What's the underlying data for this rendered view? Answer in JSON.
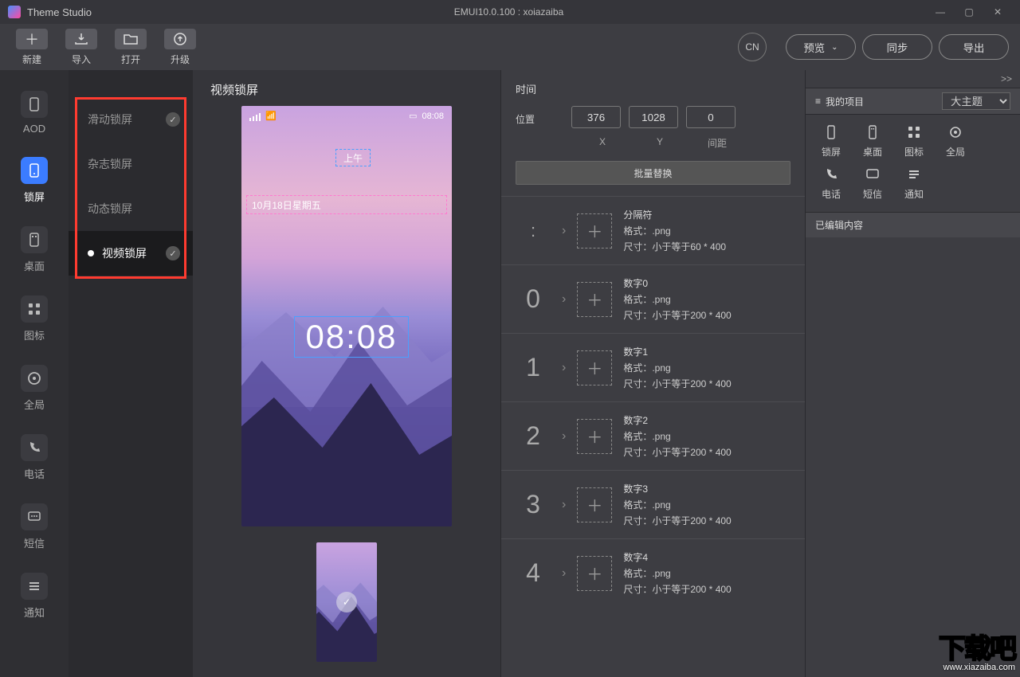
{
  "titlebar": {
    "app": "Theme Studio",
    "center": "EMUI10.0.100 : xoiazaiba"
  },
  "toolbar": {
    "new": "新建",
    "import": "导入",
    "open": "打开",
    "upgrade": "升级",
    "lang": "CN",
    "preview": "预览",
    "sync": "同步",
    "export": "导出"
  },
  "leftnav": [
    {
      "key": "aod",
      "label": "AOD"
    },
    {
      "key": "lock",
      "label": "锁屏",
      "active": true
    },
    {
      "key": "desktop",
      "label": "桌面"
    },
    {
      "key": "icons",
      "label": "图标"
    },
    {
      "key": "global",
      "label": "全局"
    },
    {
      "key": "phone",
      "label": "电话"
    },
    {
      "key": "sms",
      "label": "短信"
    },
    {
      "key": "notify",
      "label": "通知"
    }
  ],
  "subnav": [
    {
      "label": "滑动锁屏",
      "checked": true
    },
    {
      "label": "杂志锁屏"
    },
    {
      "label": "动态锁屏"
    },
    {
      "label": "视频锁屏",
      "active": true,
      "checked": true
    }
  ],
  "preview": {
    "title": "视频锁屏",
    "status_time": "08:08",
    "ampm": "上午",
    "date": "10月18日星期五",
    "clock": "08:08"
  },
  "props": {
    "section_time": "时间",
    "pos_label": "位置",
    "x": "376",
    "y": "1028",
    "gap": "0",
    "xl": "X",
    "yl": "Y",
    "gapl": "间距",
    "batch": "批量替换",
    "rows": [
      {
        "num": ":",
        "title": "分隔符",
        "fmt": "格式：.png",
        "size": "尺寸：小于等于60 * 400",
        "sep": true
      },
      {
        "num": "0",
        "title": "数字0",
        "fmt": "格式：.png",
        "size": "尺寸：小于等于200 * 400"
      },
      {
        "num": "1",
        "title": "数字1",
        "fmt": "格式：.png",
        "size": "尺寸：小于等于200 * 400"
      },
      {
        "num": "2",
        "title": "数字2",
        "fmt": "格式：.png",
        "size": "尺寸：小于等于200 * 400"
      },
      {
        "num": "3",
        "title": "数字3",
        "fmt": "格式：.png",
        "size": "尺寸：小于等于200 * 400"
      },
      {
        "num": "4",
        "title": "数字4",
        "fmt": "格式：.png",
        "size": "尺寸：小于等于200 * 400"
      }
    ]
  },
  "right": {
    "more": ">>",
    "proj_title": "我的项目",
    "proj_select": "大主题",
    "modules": [
      {
        "label": "锁屏",
        "icon": "phone"
      },
      {
        "label": "桌面",
        "icon": "desktop"
      },
      {
        "label": "图标",
        "icon": "grid"
      },
      {
        "label": "全局",
        "icon": "gear"
      },
      {
        "label": "电话",
        "icon": "call"
      },
      {
        "label": "短信",
        "icon": "chat"
      },
      {
        "label": "通知",
        "icon": "list"
      }
    ],
    "edited_title": "已编辑内容"
  },
  "watermark": {
    "big": "下载吧",
    "url": "www.xiazaiba.com"
  }
}
